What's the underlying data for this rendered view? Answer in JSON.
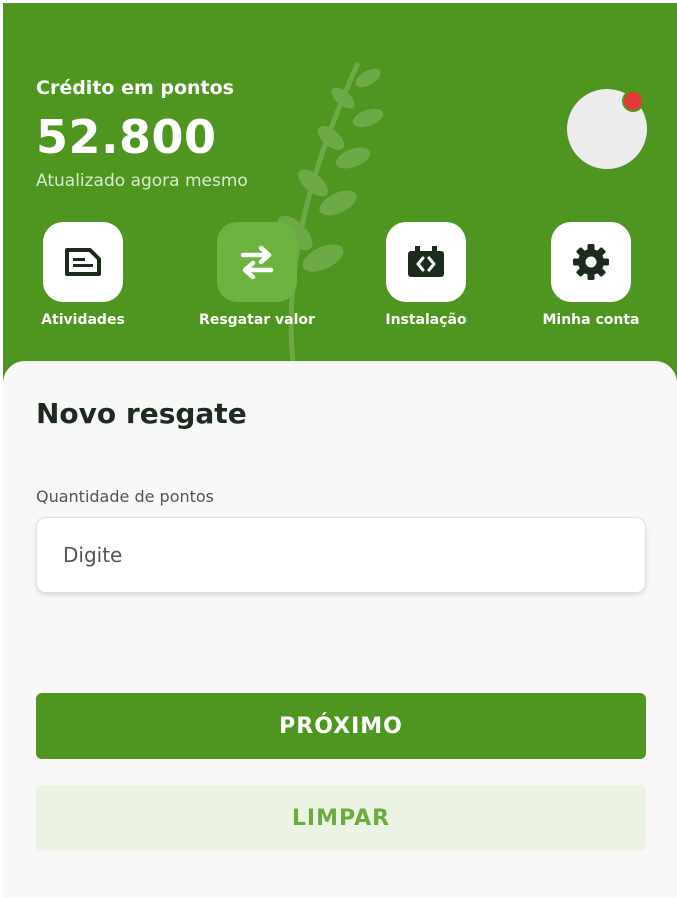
{
  "header": {
    "credit_label": "Crédito em pontos",
    "credit_value": "52.800",
    "updated_text": "Atualizado agora mesmo",
    "avatar_status": "notification-dot"
  },
  "actions": [
    {
      "label": "Atividades",
      "icon": "document-icon",
      "active": false
    },
    {
      "label": "Resgatar valor",
      "icon": "swap-arrows-icon",
      "active": true
    },
    {
      "label": "Instalação",
      "icon": "code-device-icon",
      "active": false
    },
    {
      "label": "Minha conta",
      "icon": "gear-icon",
      "active": false
    }
  ],
  "form": {
    "title": "Novo resgate",
    "field_label": "Quantidade de pontos",
    "field_value": "",
    "field_placeholder": "Digite",
    "next_label": "PRÓXIMO",
    "clear_label": "LIMPAR"
  },
  "colors": {
    "brand_green": "#4e961f",
    "active_green": "#6db33f",
    "clear_bg": "#ebf4e3",
    "clear_text": "#6bab3f",
    "notification_red": "#e53935"
  }
}
